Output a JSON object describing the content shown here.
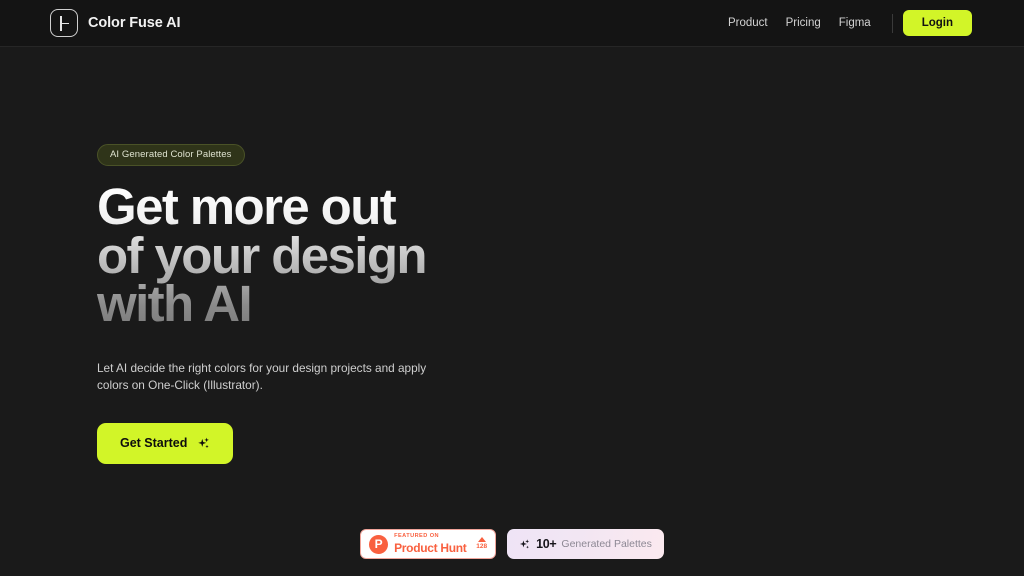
{
  "header": {
    "brand": {
      "name": "Color Fuse AI",
      "logo_icon": "square-bracket-logo-icon"
    },
    "nav": [
      {
        "label": "Product"
      },
      {
        "label": "Pricing"
      },
      {
        "label": "Figma"
      }
    ],
    "login_label": "Login"
  },
  "hero": {
    "pill_label": "AI Generated Color Palettes",
    "headline_lines": [
      "Get more out",
      "of your design",
      "with AI"
    ],
    "subtext": "Let AI decide the right colors for your design projects and apply colors on One-Click (Illustrator).",
    "cta_label": "Get Started",
    "cta_icon": "sparkles-icon"
  },
  "badges": {
    "product_hunt": {
      "featured_label": "FEATURED ON",
      "name": "Product Hunt",
      "logo_letter": "P",
      "upvote_icon": "upvote-triangle-icon",
      "vote_count": "128"
    },
    "generated_palettes": {
      "icon": "sparkles-icon",
      "count": "10+",
      "label": "Generated Palettes"
    }
  },
  "colors": {
    "accent": "#d2f528",
    "page_bg": "#1a1a1a",
    "header_bg": "#141414",
    "pill_bg": "#2f3419",
    "product_hunt": "#f9603f"
  }
}
